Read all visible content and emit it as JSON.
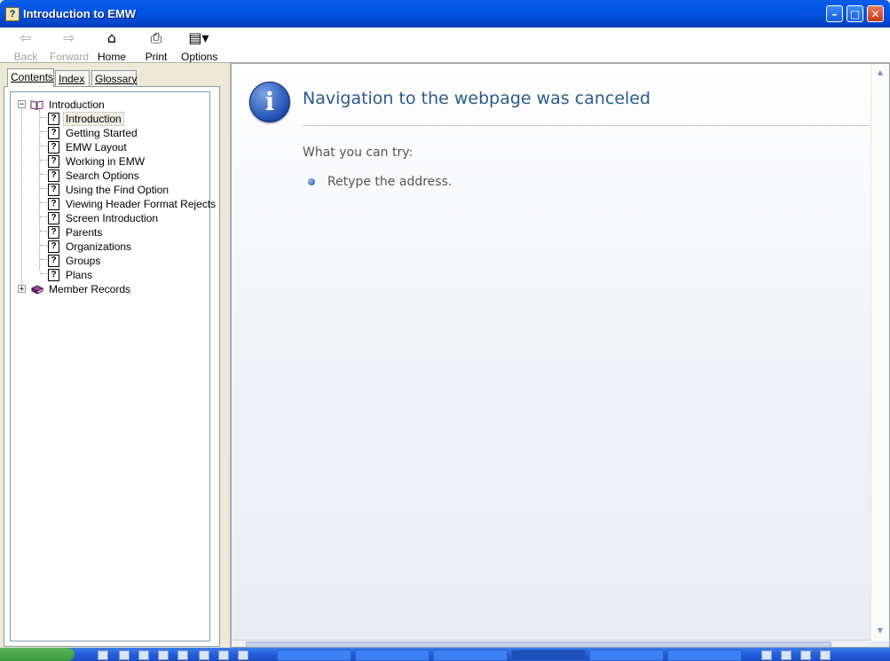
{
  "window": {
    "title": "Introduction to EMW",
    "app_icon": "help-file-icon"
  },
  "toolbar": {
    "back": "Back",
    "forward": "Forward",
    "home": "Home",
    "print": "Print",
    "options": "Options"
  },
  "nav_tabs": {
    "contents": "Contents",
    "index": "Index",
    "glossary": "Glossary"
  },
  "tree": {
    "root": "Introduction",
    "children": [
      "Introduction",
      "Getting Started",
      "EMW Layout",
      "Working in EMW",
      "Search Options",
      "Using the Find Option",
      "Viewing Header Format Rejects",
      "Screen Introduction",
      "Parents",
      "Organizations",
      "Groups",
      "Plans"
    ],
    "selected_index": 0,
    "second_book": "Member Records"
  },
  "content": {
    "heading": "Navigation to the webpage was canceled",
    "try_label": "What you can try:",
    "items": [
      "Retype the address."
    ]
  },
  "colors": {
    "titlebar": "#0255e4",
    "heading": "#2a5a8c",
    "body_text": "#555555"
  }
}
